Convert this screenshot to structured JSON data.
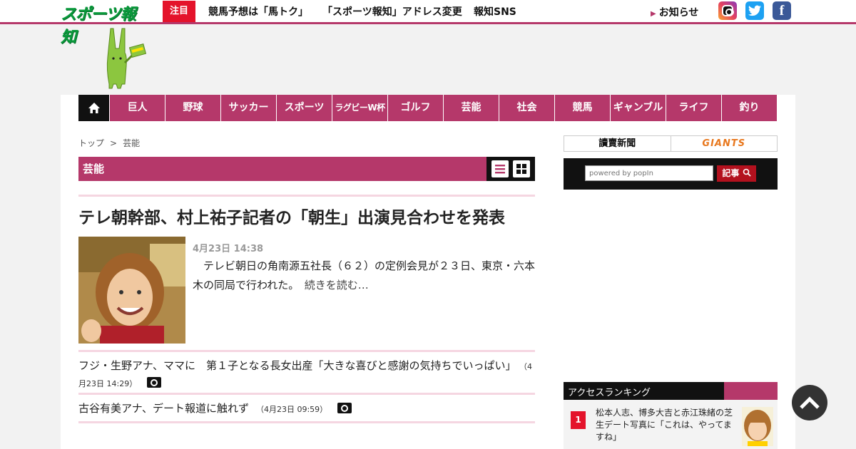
{
  "header": {
    "logo_text": "スポーツ報知",
    "badge": "注目",
    "links": [
      "競馬予想は「馬トク」",
      "「スポーツ報知」アドレス変更",
      "報知SNS"
    ],
    "notice": "お知らせ",
    "sns": [
      "instagram-icon",
      "twitter-icon",
      "facebook-icon"
    ]
  },
  "nav": {
    "items": [
      "巨人",
      "野球",
      "サッカー",
      "スポーツ",
      "ラグビーW杯",
      "ゴルフ",
      "芸能",
      "社会",
      "競馬",
      "ギャンブル",
      "ライフ",
      "釣り"
    ]
  },
  "breadcrumb": {
    "home": "トップ",
    "sep": ">",
    "current": "芸能"
  },
  "section": {
    "title": "芸能"
  },
  "lead": {
    "headline": "テレ朝幹部、村上祐子記者の「朝生」出演見合わせを発表",
    "date": "4月23日 14:38",
    "summary": "　テレビ朝日の角南源五社長（６２）の定例会見が２３日、東京・六本木の同局で行われた。",
    "more": "続きを読む…"
  },
  "articles": [
    {
      "title": "フジ・生野アナ、ママに　第１子となる長女出産「大きな喜びと感謝の気持ちでいっぱい」",
      "time": "（4月23日 14:29）"
    },
    {
      "title": "古谷有美アナ、デート報道に触れず",
      "time": "（4月23日 09:59）"
    }
  ],
  "sidebar": {
    "partners": [
      "讀賣新聞",
      "GIANTS"
    ],
    "search": {
      "placeholder": "powered by popIn",
      "button": "記事"
    },
    "ranking": {
      "title": "アクセスランキング",
      "items": [
        {
          "rank": "1",
          "title": "松本人志、博多大吉と赤江珠緒の芝生デート写真に「これは、やってますね」"
        }
      ]
    }
  },
  "colors": {
    "accent": "#b5386a",
    "badge": "#e4132b",
    "logo": "#0a9a3c"
  }
}
